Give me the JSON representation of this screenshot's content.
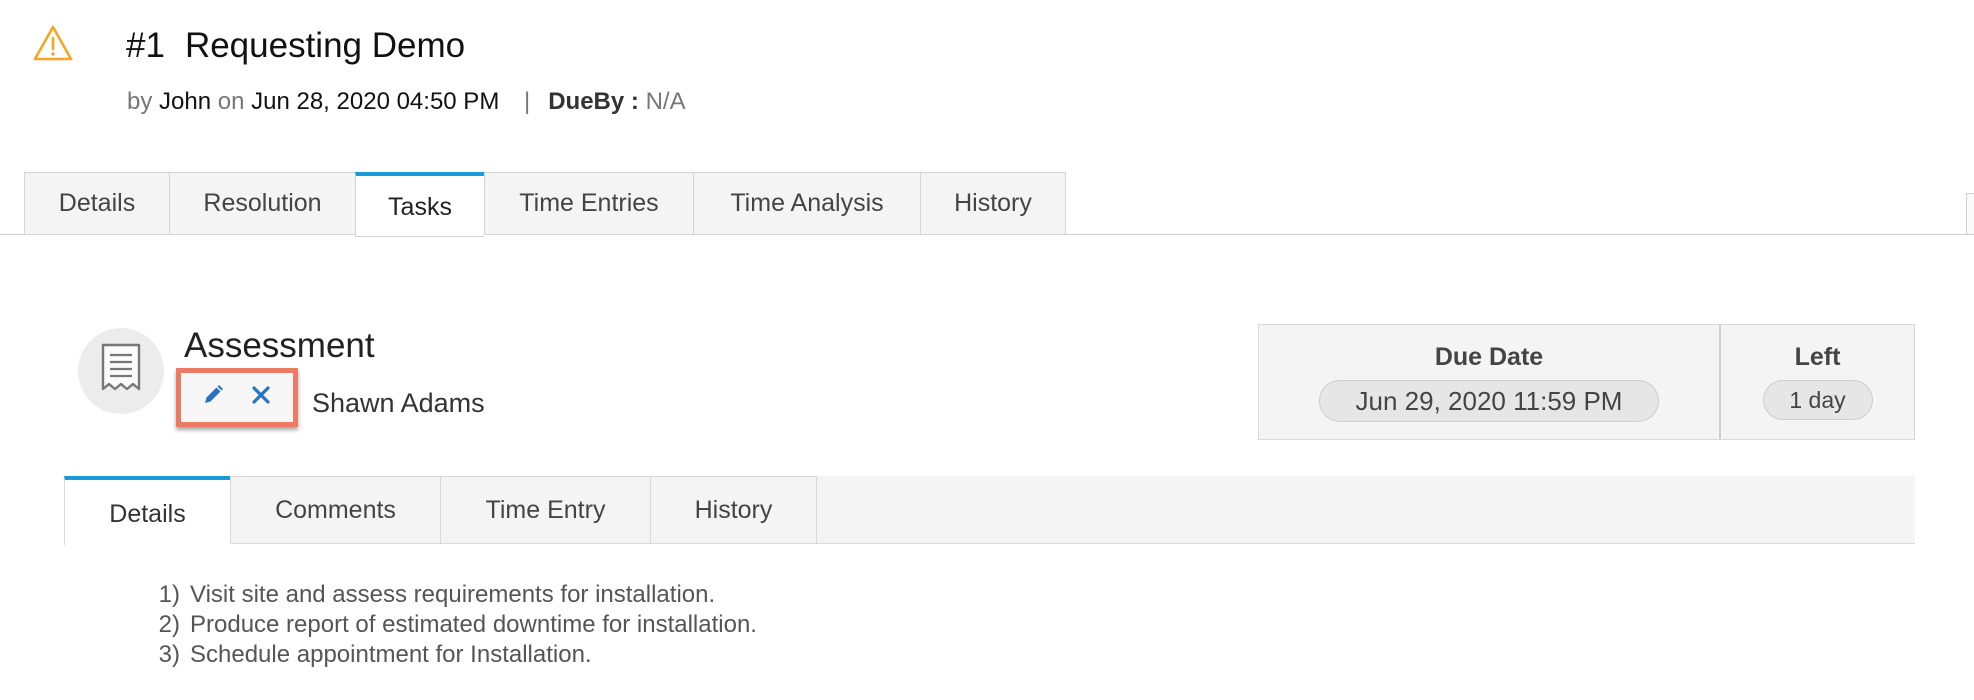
{
  "ticket": {
    "number": "#1",
    "title": "Requesting Demo",
    "by_label": "by",
    "author": "John",
    "on_label": "on",
    "created": "Jun 28, 2020 04:50 PM",
    "separator": "|",
    "dueby_label": "DueBy :",
    "dueby_value": "N/A",
    "status_icon": "warning-triangle-icon"
  },
  "main_tabs": [
    {
      "label": "Details",
      "active": false
    },
    {
      "label": "Resolution",
      "active": false
    },
    {
      "label": "Tasks",
      "active": true
    },
    {
      "label": "Time Entries",
      "active": false
    },
    {
      "label": "Time Analysis",
      "active": false
    },
    {
      "label": "History",
      "active": false
    }
  ],
  "task": {
    "title": "Assessment",
    "assignee": "Shawn Adams",
    "icon": "receipt-document-icon",
    "actions": [
      {
        "name": "edit",
        "icon": "pencil-icon"
      },
      {
        "name": "delete",
        "icon": "close-icon"
      }
    ],
    "due_date_label": "Due Date",
    "due_date": "Jun 29, 2020 11:59 PM",
    "left_label": "Left",
    "left_value": "1 day"
  },
  "sub_tabs": [
    {
      "label": "Details",
      "active": true
    },
    {
      "label": "Comments",
      "active": false
    },
    {
      "label": "Time Entry",
      "active": false
    },
    {
      "label": "History",
      "active": false
    }
  ],
  "description": [
    {
      "num": "1)",
      "text": "Visit site and assess requirements for installation."
    },
    {
      "num": "2)",
      "text": "Produce report of estimated downtime for installation."
    },
    {
      "num": "3)",
      "text": "Schedule appointment for Installation."
    }
  ],
  "colors": {
    "accent": "#1a9ad6",
    "warning": "#f5a623",
    "highlight_border": "#ec7b63",
    "action_icon": "#2a73c4"
  }
}
